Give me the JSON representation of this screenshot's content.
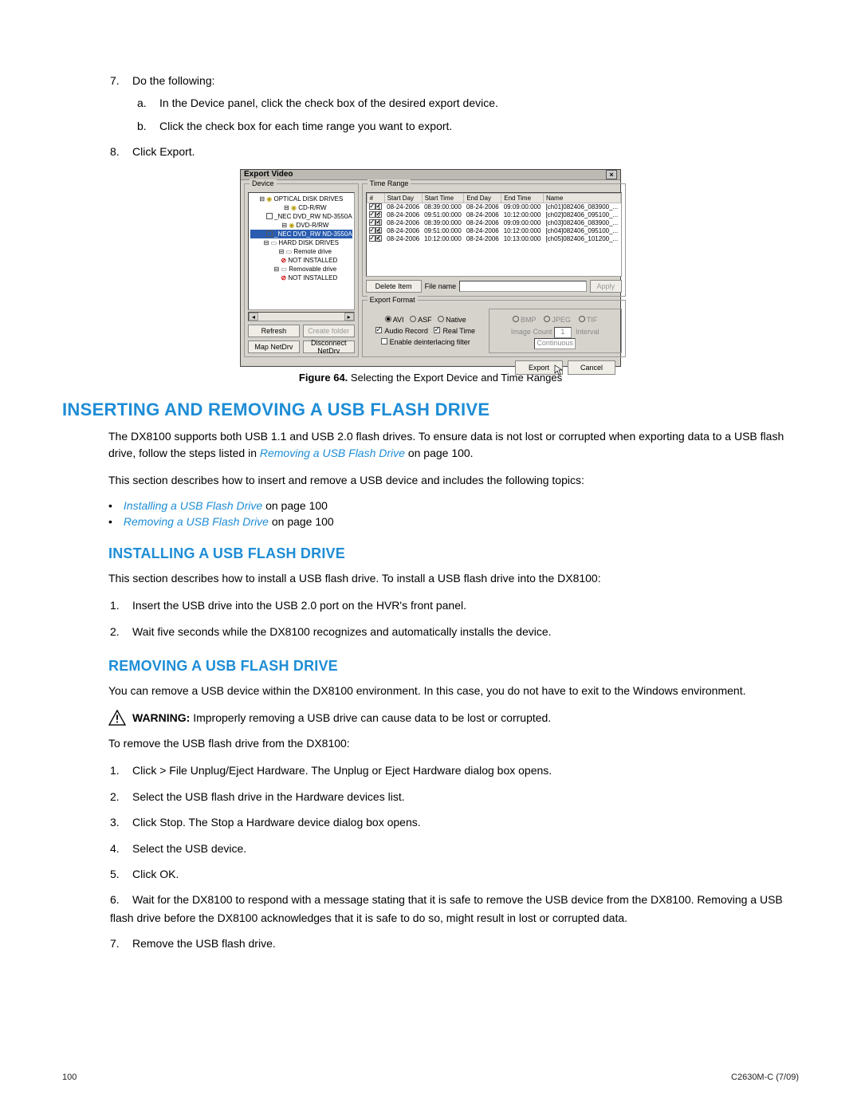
{
  "steps_top": [
    {
      "n": "7.",
      "text": "Do the following:",
      "sub": [
        {
          "n": "a.",
          "text": "In the Device panel, click the check box of the desired export device."
        },
        {
          "n": "b.",
          "text": "Click the check box for each time range you want to export."
        }
      ]
    },
    {
      "n": "8.",
      "text": "Click Export."
    }
  ],
  "figure": {
    "label": "Figure 64.",
    "caption": "Selecting the Export Device and Time Ranges"
  },
  "h1": "INSERTING AND REMOVING A USB FLASH DRIVE",
  "intro1_a": "The DX8100 supports both USB 1.1 and USB 2.0 flash drives. To ensure data is not lost or corrupted when exporting data to a USB flash drive, follow the steps listed in ",
  "intro1_link": "Removing a USB Flash Drive",
  "intro1_b": " on page 100.",
  "intro2": "This section describes how to insert and remove a USB device and includes the following topics:",
  "bullets": [
    {
      "link": "Installing a USB Flash Drive",
      "tail": " on page 100"
    },
    {
      "link": "Removing a USB Flash Drive",
      "tail": " on page 100"
    }
  ],
  "h2a": "INSTALLING A USB FLASH DRIVE",
  "install_p": "This section describes how to install a USB flash drive. To install a USB flash drive into the DX8100:",
  "install_steps": [
    {
      "n": "1.",
      "text": "Insert the USB drive into the USB 2.0 port on the HVR's front panel."
    },
    {
      "n": "2.",
      "text": "Wait five seconds while the DX8100 recognizes and automatically installs the device."
    }
  ],
  "h2b": "REMOVING A USB FLASH DRIVE",
  "remove_p1": "You can remove a USB device within the DX8100 environment. In this case, you do not have to exit to the Windows environment.",
  "warn_label": "WARNING:",
  "warn_text": "  Improperly removing a USB drive can cause data to be lost or corrupted.",
  "remove_p2": "To remove the USB flash drive from the DX8100:",
  "remove_steps": [
    {
      "n": "1.",
      "text": "Click > File Unplug/Eject Hardware. The Unplug or Eject Hardware dialog box opens."
    },
    {
      "n": "2.",
      "text": "Select the USB flash drive in the Hardware devices list."
    },
    {
      "n": "3.",
      "text": "Click Stop. The Stop a Hardware device dialog box opens."
    },
    {
      "n": "4.",
      "text": "Select the USB device."
    },
    {
      "n": "5.",
      "text": "Click OK."
    },
    {
      "n": "6.",
      "text": "Wait for the DX8100 to respond with a message stating that it is safe to remove the USB device from the DX8100. Removing a USB flash drive before the DX8100 acknowledges that it is safe to do so, might result in lost or corrupted data."
    },
    {
      "n": "7.",
      "text": "Remove the USB flash drive."
    }
  ],
  "footer": {
    "page": "100",
    "doc": "C2630M-C (7/09)"
  },
  "dialog": {
    "title": "Export Video",
    "device_legend": "Device",
    "tree": [
      {
        "indent": 0,
        "icon": "cd",
        "text": "OPTICAL DISK DRIVES"
      },
      {
        "indent": 1,
        "icon": "cd",
        "text": "CD-R/RW"
      },
      {
        "indent": 2,
        "icon": "box",
        "text": "_NEC    DVD_RW ND-3550A"
      },
      {
        "indent": 1,
        "icon": "cd",
        "text": "DVD-R/RW"
      },
      {
        "indent": 2,
        "icon": "boxsel",
        "text": "_NEC    DVD_RW ND-3550A"
      },
      {
        "indent": 0,
        "icon": "hd",
        "text": "HARD DISK DRIVES"
      },
      {
        "indent": 1,
        "icon": "hd",
        "text": "Remote drive"
      },
      {
        "indent": 2,
        "icon": "no",
        "text": "NOT INSTALLED"
      },
      {
        "indent": 1,
        "icon": "hd",
        "text": "Removable drive"
      },
      {
        "indent": 2,
        "icon": "no",
        "text": "NOT INSTALLED"
      }
    ],
    "btn_refresh": "Refresh",
    "btn_create": "Create folder",
    "btn_map": "Map NetDrv",
    "btn_disc": "Disconnect NetDrv",
    "time_legend": "Time Range",
    "cols": [
      "#",
      "Start Day",
      "Start Time",
      "End Day",
      "End Time",
      "Name"
    ],
    "rows": [
      [
        "1",
        "08-24-2006",
        "08:39:00:000",
        "08-24-2006",
        "09:09:00:000",
        "[ch01]082406_083900_..."
      ],
      [
        "2",
        "08-24-2006",
        "09:51:00:000",
        "08-24-2006",
        "10:12:00:000",
        "[ch02]082406_095100_..."
      ],
      [
        "3",
        "08-24-2006",
        "08:39:00:000",
        "08-24-2006",
        "09:09:00:000",
        "[ch03]082406_083900_..."
      ],
      [
        "4",
        "08-24-2006",
        "09:51:00:000",
        "08-24-2006",
        "10:12:00:000",
        "[ch04]082406_095100_..."
      ],
      [
        "5",
        "08-24-2006",
        "10:12:00:000",
        "08-24-2006",
        "10:13:00:000",
        "[ch05]082406_101200_..."
      ]
    ],
    "btn_delete": "Delete Item",
    "lbl_filename": "File name",
    "btn_apply": "Apply",
    "ef_legend": "Export Format",
    "fmt": {
      "avi": "AVI",
      "asf": "ASF",
      "native": "Native"
    },
    "audio": "Audio Record",
    "realtime": "Real Time",
    "deint": "Enable deinterlacing filter",
    "img": {
      "bmp": "BMP",
      "jpeg": "JPEG",
      "tif": "TIF",
      "count": "Image Count",
      "count_v": "1",
      "interval": "Interval",
      "interval_v": "Continuous"
    },
    "btn_export": "Export",
    "btn_cancel": "Cancel"
  }
}
